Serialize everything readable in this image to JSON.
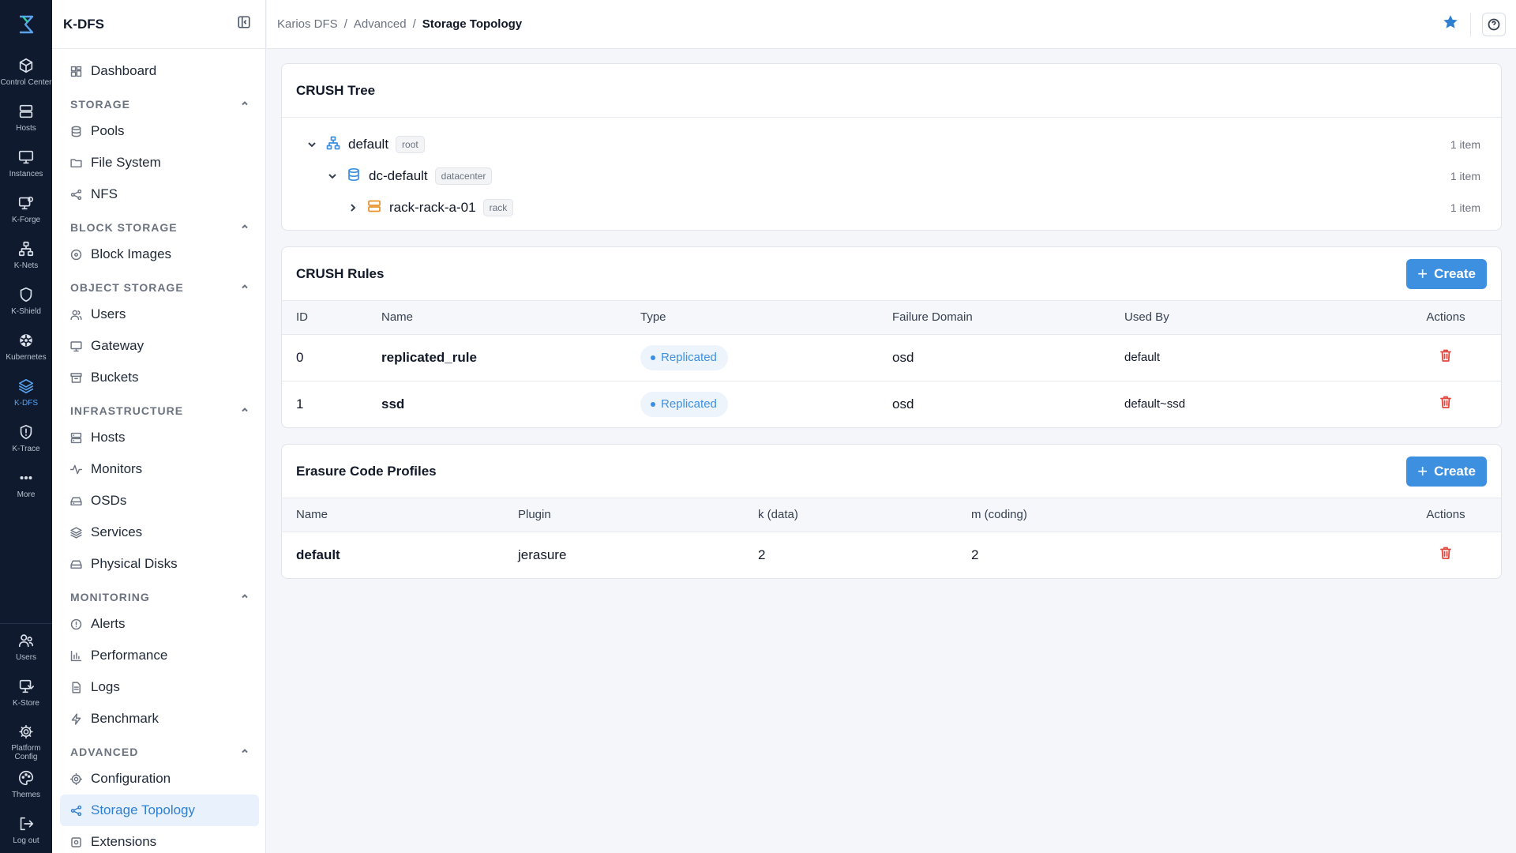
{
  "rail": {
    "top": [
      {
        "label": "Control Center",
        "icon": "cube-icon"
      },
      {
        "label": "Hosts",
        "icon": "server-icon"
      },
      {
        "label": "Instances",
        "icon": "monitor-icon"
      },
      {
        "label": "K-Forge",
        "icon": "forge-icon"
      },
      {
        "label": "K-Nets",
        "icon": "network-icon"
      },
      {
        "label": "K-Shield",
        "icon": "shield-icon"
      },
      {
        "label": "Kubernetes",
        "icon": "kubernetes-icon"
      },
      {
        "label": "K-DFS",
        "icon": "layers-icon",
        "active": true
      },
      {
        "label": "K-Trace",
        "icon": "trace-icon"
      },
      {
        "label": "More",
        "icon": "more-icon"
      }
    ],
    "bottom": [
      {
        "label": "Users",
        "icon": "users-icon"
      },
      {
        "label": "K-Store",
        "icon": "store-icon"
      },
      {
        "label": "Platform Config",
        "icon": "gear-icon"
      },
      {
        "label": "Themes",
        "icon": "palette-icon"
      },
      {
        "label": "Log out",
        "icon": "logout-icon"
      }
    ]
  },
  "sidebar": {
    "title": "K-DFS",
    "dashboard": "Dashboard",
    "sections": {
      "storage": {
        "label": "STORAGE",
        "items": [
          "Pools",
          "File System",
          "NFS"
        ]
      },
      "block": {
        "label": "BLOCK STORAGE",
        "items": [
          "Block Images"
        ]
      },
      "object": {
        "label": "OBJECT STORAGE",
        "items": [
          "Users",
          "Gateway",
          "Buckets"
        ]
      },
      "infra": {
        "label": "INFRASTRUCTURE",
        "items": [
          "Hosts",
          "Monitors",
          "OSDs",
          "Services",
          "Physical Disks"
        ]
      },
      "monitoring": {
        "label": "MONITORING",
        "items": [
          "Alerts",
          "Performance",
          "Logs",
          "Benchmark"
        ]
      },
      "advanced": {
        "label": "ADVANCED",
        "items": [
          "Configuration",
          "Storage Topology",
          "Extensions"
        ]
      }
    }
  },
  "breadcrumb": [
    "Karios DFS",
    "Advanced",
    "Storage Topology"
  ],
  "crush_tree": {
    "title": "CRUSH Tree",
    "nodes": [
      {
        "name": "default",
        "type": "root",
        "count": "1 item"
      },
      {
        "name": "dc-default",
        "type": "datacenter",
        "count": "1 item"
      },
      {
        "name": "rack-rack-a-01",
        "type": "rack",
        "count": "1 item"
      }
    ]
  },
  "crush_rules": {
    "title": "CRUSH Rules",
    "create_label": "Create",
    "plus": "+",
    "columns": [
      "ID",
      "Name",
      "Type",
      "Failure Domain",
      "Used By",
      "Actions"
    ],
    "rows": [
      {
        "id": "0",
        "name": "replicated_rule",
        "type": "Replicated",
        "failure_domain": "osd",
        "used_by": "default"
      },
      {
        "id": "1",
        "name": "ssd",
        "type": "Replicated",
        "failure_domain": "osd",
        "used_by": "default~ssd"
      }
    ]
  },
  "ec_profiles": {
    "title": "Erasure Code Profiles",
    "create_label": "Create",
    "plus": "+",
    "columns": [
      "Name",
      "Plugin",
      "k (data)",
      "m (coding)",
      "Actions"
    ],
    "rows": [
      {
        "name": "default",
        "plugin": "jerasure",
        "k": "2",
        "m": "2"
      }
    ]
  },
  "colors": {
    "accent": "#3d8fe0",
    "rail_bg": "#0f1a2e",
    "danger": "#e0473e"
  }
}
